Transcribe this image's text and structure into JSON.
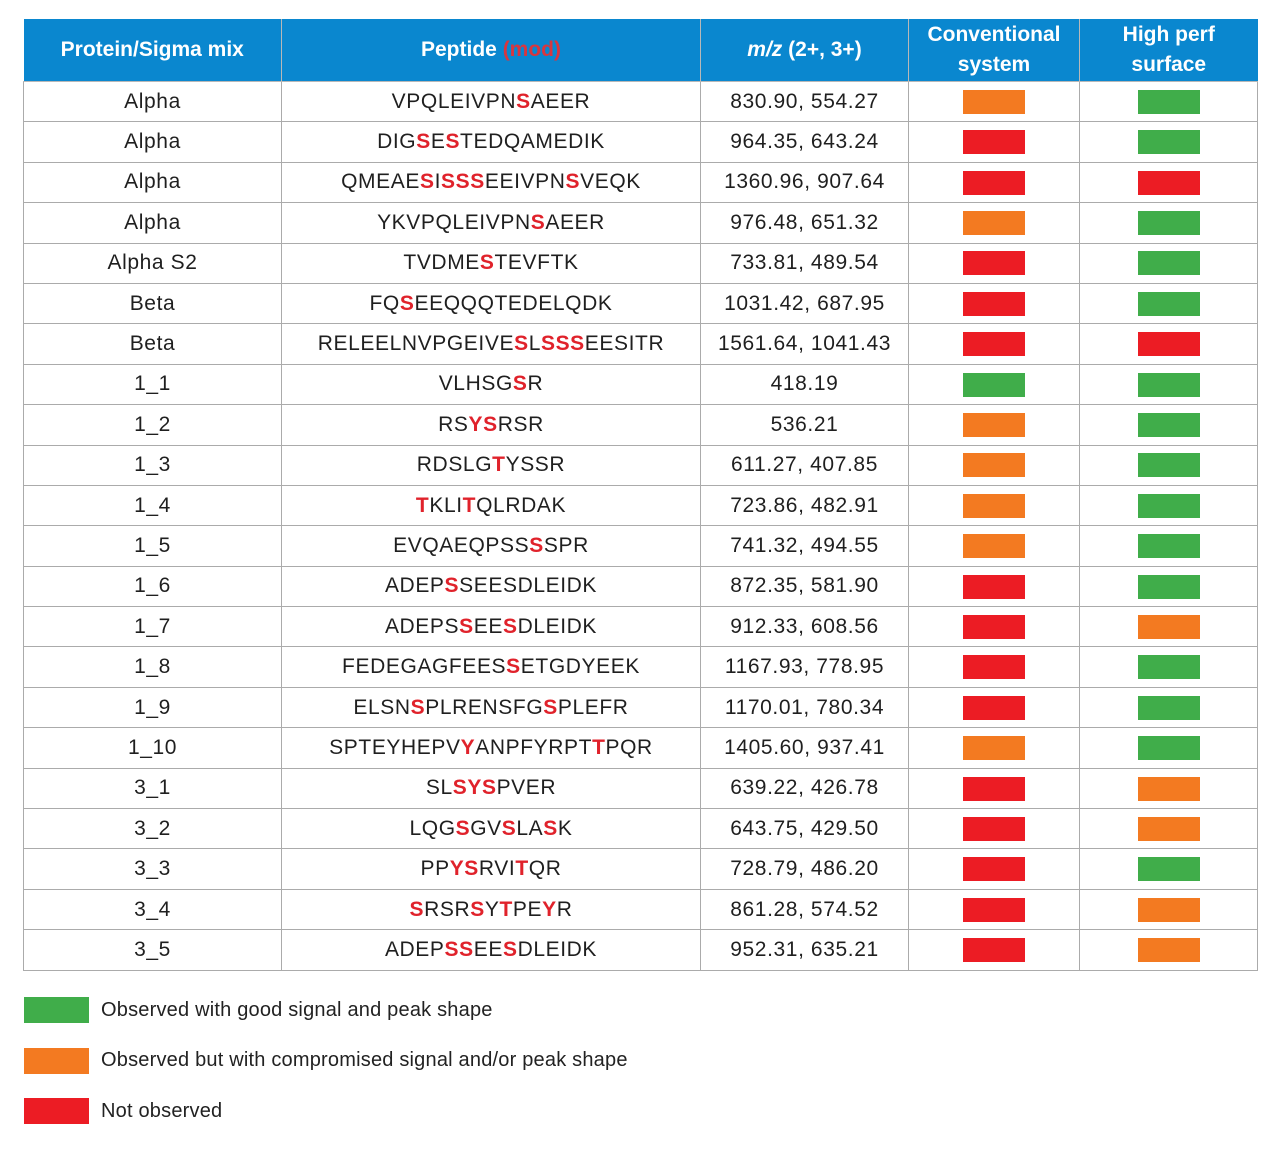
{
  "colors": {
    "header_bg": "#0a87cf",
    "good": "#40ad4a",
    "compromised": "#f37a21",
    "not_observed": "#ec1c24",
    "mod_residue": "#e0222b"
  },
  "table": {
    "headers": {
      "protein": "Protein/Sigma mix",
      "peptide": "Peptide",
      "peptide_mod": "(mod)",
      "mz_italic": "m/z",
      "mz_rest": " (2+, 3+)",
      "conventional_line1": "Conventional",
      "conventional_line2": "system",
      "highperf_line1": "High perf",
      "highperf_line2": "surface"
    },
    "rows": [
      {
        "protein": "Alpha",
        "peptide": [
          [
            "VPQLEIVPN",
            0
          ],
          [
            "S",
            1
          ],
          [
            "AEER",
            0
          ]
        ],
        "mz": "830.90, 554.27",
        "conventional": "compromised",
        "high_perf": "good"
      },
      {
        "protein": "Alpha",
        "peptide": [
          [
            "DIG",
            0
          ],
          [
            "S",
            1
          ],
          [
            "E",
            0
          ],
          [
            "S",
            1
          ],
          [
            "TEDQAMEDIK",
            0
          ]
        ],
        "mz": "964.35, 643.24",
        "conventional": "not_observed",
        "high_perf": "good"
      },
      {
        "protein": "Alpha",
        "peptide": [
          [
            "QMEAE",
            0
          ],
          [
            "S",
            1
          ],
          [
            "I",
            0
          ],
          [
            "SSS",
            1
          ],
          [
            "EEIVPN",
            0
          ],
          [
            "S",
            1
          ],
          [
            "VEQK",
            0
          ]
        ],
        "mz": "1360.96, 907.64",
        "conventional": "not_observed",
        "high_perf": "not_observed"
      },
      {
        "protein": "Alpha",
        "peptide": [
          [
            "YKVPQLEIVPN",
            0
          ],
          [
            "S",
            1
          ],
          [
            "AEER",
            0
          ]
        ],
        "mz": "976.48, 651.32",
        "conventional": "compromised",
        "high_perf": "good"
      },
      {
        "protein": "Alpha S2",
        "peptide": [
          [
            "TVDME",
            0
          ],
          [
            "S",
            1
          ],
          [
            "TEVFTK",
            0
          ]
        ],
        "mz": "733.81, 489.54",
        "conventional": "not_observed",
        "high_perf": "good"
      },
      {
        "protein": "Beta",
        "peptide": [
          [
            "FQ",
            0
          ],
          [
            "S",
            1
          ],
          [
            "EEQQQTEDELQDK",
            0
          ]
        ],
        "mz": "1031.42, 687.95",
        "conventional": "not_observed",
        "high_perf": "good"
      },
      {
        "protein": "Beta",
        "peptide": [
          [
            "RELEELNVPGEIVE",
            0
          ],
          [
            "S",
            1
          ],
          [
            "L",
            0
          ],
          [
            "SSS",
            1
          ],
          [
            "EESITR",
            0
          ]
        ],
        "mz": "1561.64, 1041.43",
        "conventional": "not_observed",
        "high_perf": "not_observed"
      },
      {
        "protein": "1_1",
        "peptide": [
          [
            "VLHSG",
            0
          ],
          [
            "S",
            1
          ],
          [
            "R",
            0
          ]
        ],
        "mz": "418.19",
        "conventional": "good",
        "high_perf": "good"
      },
      {
        "protein": "1_2",
        "peptide": [
          [
            "RS",
            0
          ],
          [
            "YS",
            1
          ],
          [
            "RSR",
            0
          ]
        ],
        "mz": "536.21",
        "conventional": "compromised",
        "high_perf": "good"
      },
      {
        "protein": "1_3",
        "peptide": [
          [
            "RDSLG",
            0
          ],
          [
            "T",
            1
          ],
          [
            "YSSR",
            0
          ]
        ],
        "mz": "611.27, 407.85",
        "conventional": "compromised",
        "high_perf": "good"
      },
      {
        "protein": "1_4",
        "peptide": [
          [
            "T",
            1
          ],
          [
            "KLI",
            0
          ],
          [
            "T",
            1
          ],
          [
            "QLRDAK",
            0
          ]
        ],
        "mz": "723.86, 482.91",
        "conventional": "compromised",
        "high_perf": "good"
      },
      {
        "protein": "1_5",
        "peptide": [
          [
            "EVQAEQPSS",
            0
          ],
          [
            "S",
            1
          ],
          [
            "SPR",
            0
          ]
        ],
        "mz": "741.32, 494.55",
        "conventional": "compromised",
        "high_perf": "good"
      },
      {
        "protein": "1_6",
        "peptide": [
          [
            "ADEP",
            0
          ],
          [
            "S",
            1
          ],
          [
            "SEESDLEIDK",
            0
          ]
        ],
        "mz": "872.35, 581.90",
        "conventional": "not_observed",
        "high_perf": "good"
      },
      {
        "protein": "1_7",
        "peptide": [
          [
            "ADEPS",
            0
          ],
          [
            "S",
            1
          ],
          [
            "EE",
            0
          ],
          [
            "S",
            1
          ],
          [
            "DLEIDK",
            0
          ]
        ],
        "mz": "912.33, 608.56",
        "conventional": "not_observed",
        "high_perf": "compromised"
      },
      {
        "protein": "1_8",
        "peptide": [
          [
            "FEDEGAGFEES",
            0
          ],
          [
            "S",
            1
          ],
          [
            "ETGDYEEK",
            0
          ]
        ],
        "mz": "1167.93, 778.95",
        "conventional": "not_observed",
        "high_perf": "good"
      },
      {
        "protein": "1_9",
        "peptide": [
          [
            "ELSN",
            0
          ],
          [
            "S",
            1
          ],
          [
            "PLRENSFG",
            0
          ],
          [
            "S",
            1
          ],
          [
            "PLEFR",
            0
          ]
        ],
        "mz": "1170.01, 780.34",
        "conventional": "not_observed",
        "high_perf": "good"
      },
      {
        "protein": "1_10",
        "peptide": [
          [
            "SPTEYHEPV",
            0
          ],
          [
            "Y",
            1
          ],
          [
            "ANPFYRPT",
            0
          ],
          [
            "T",
            1
          ],
          [
            "PQR",
            0
          ]
        ],
        "mz": "1405.60, 937.41",
        "conventional": "compromised",
        "high_perf": "good"
      },
      {
        "protein": "3_1",
        "peptide": [
          [
            "SL",
            0
          ],
          [
            "SYS",
            1
          ],
          [
            "PVER",
            0
          ]
        ],
        "mz": "639.22, 426.78",
        "conventional": "not_observed",
        "high_perf": "compromised"
      },
      {
        "protein": "3_2",
        "peptide": [
          [
            "LQG",
            0
          ],
          [
            "S",
            1
          ],
          [
            "GV",
            0
          ],
          [
            "S",
            1
          ],
          [
            "LA",
            0
          ],
          [
            "S",
            1
          ],
          [
            "K",
            0
          ]
        ],
        "mz": "643.75, 429.50",
        "conventional": "not_observed",
        "high_perf": "compromised"
      },
      {
        "protein": "3_3",
        "peptide": [
          [
            "PP",
            0
          ],
          [
            "YS",
            1
          ],
          [
            "RVI",
            0
          ],
          [
            "T",
            1
          ],
          [
            "QR",
            0
          ]
        ],
        "mz": "728.79, 486.20",
        "conventional": "not_observed",
        "high_perf": "good"
      },
      {
        "protein": "3_4",
        "peptide": [
          [
            "S",
            1
          ],
          [
            "RSR",
            0
          ],
          [
            "S",
            1
          ],
          [
            "Y",
            0
          ],
          [
            "T",
            1
          ],
          [
            "PE",
            0
          ],
          [
            "Y",
            1
          ],
          [
            "R",
            0
          ]
        ],
        "mz": "861.28, 574.52",
        "conventional": "not_observed",
        "high_perf": "compromised"
      },
      {
        "protein": "3_5",
        "peptide": [
          [
            "ADEP",
            0
          ],
          [
            "SS",
            1
          ],
          [
            "EE",
            0
          ],
          [
            "S",
            1
          ],
          [
            "DLEIDK",
            0
          ]
        ],
        "mz": "952.31, 635.21",
        "conventional": "not_observed",
        "high_perf": "compromised"
      }
    ]
  },
  "legend": [
    {
      "status": "good",
      "label": "Observed with good signal and peak shape"
    },
    {
      "status": "compromised",
      "label": "Observed but with compromised signal and/or peak shape"
    },
    {
      "status": "not_observed",
      "label": "Not observed"
    }
  ]
}
